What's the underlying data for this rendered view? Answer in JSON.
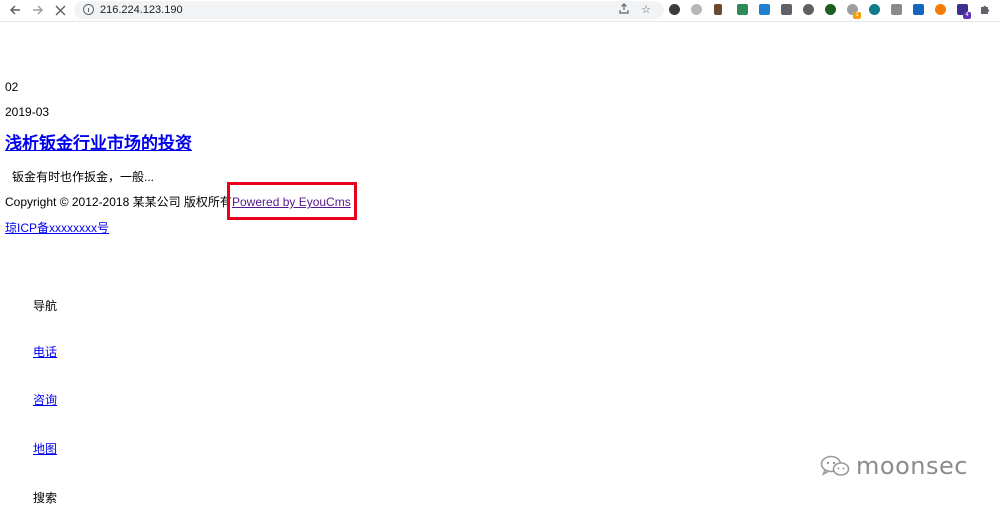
{
  "browser": {
    "url": "216.224.123.190",
    "icons": {
      "back": "arrow-left-icon",
      "forward": "arrow-right-icon",
      "stop": "close-icon",
      "site_info": "info-icon",
      "share": "share-icon",
      "bookmark": "star-icon",
      "extensions_menu": "puzzle-icon"
    },
    "extension_badges": [
      "1",
      "4"
    ],
    "colors": {
      "omnibox_bg": "#f1f3f4",
      "toolbar_text": "#5f6368"
    }
  },
  "article": {
    "day": "02",
    "month": "2019-03",
    "title": "浅析钣金行业市场的投资",
    "summary": "钣金有时也作扳金，一般..."
  },
  "footer": {
    "copyright": "Copyright © 2012-2018 某某公司 版权所有",
    "powered_by": "Powered by EyouCms",
    "icp": "琼ICP备xxxxxxxx号"
  },
  "mobile_nav": {
    "items": [
      "导航",
      "电话",
      "咨询",
      "地图",
      "搜索"
    ]
  },
  "annotation": {
    "highlight_color": "#e8001c"
  },
  "watermark": {
    "text": "moonsec",
    "icon": "wechat-icon"
  }
}
